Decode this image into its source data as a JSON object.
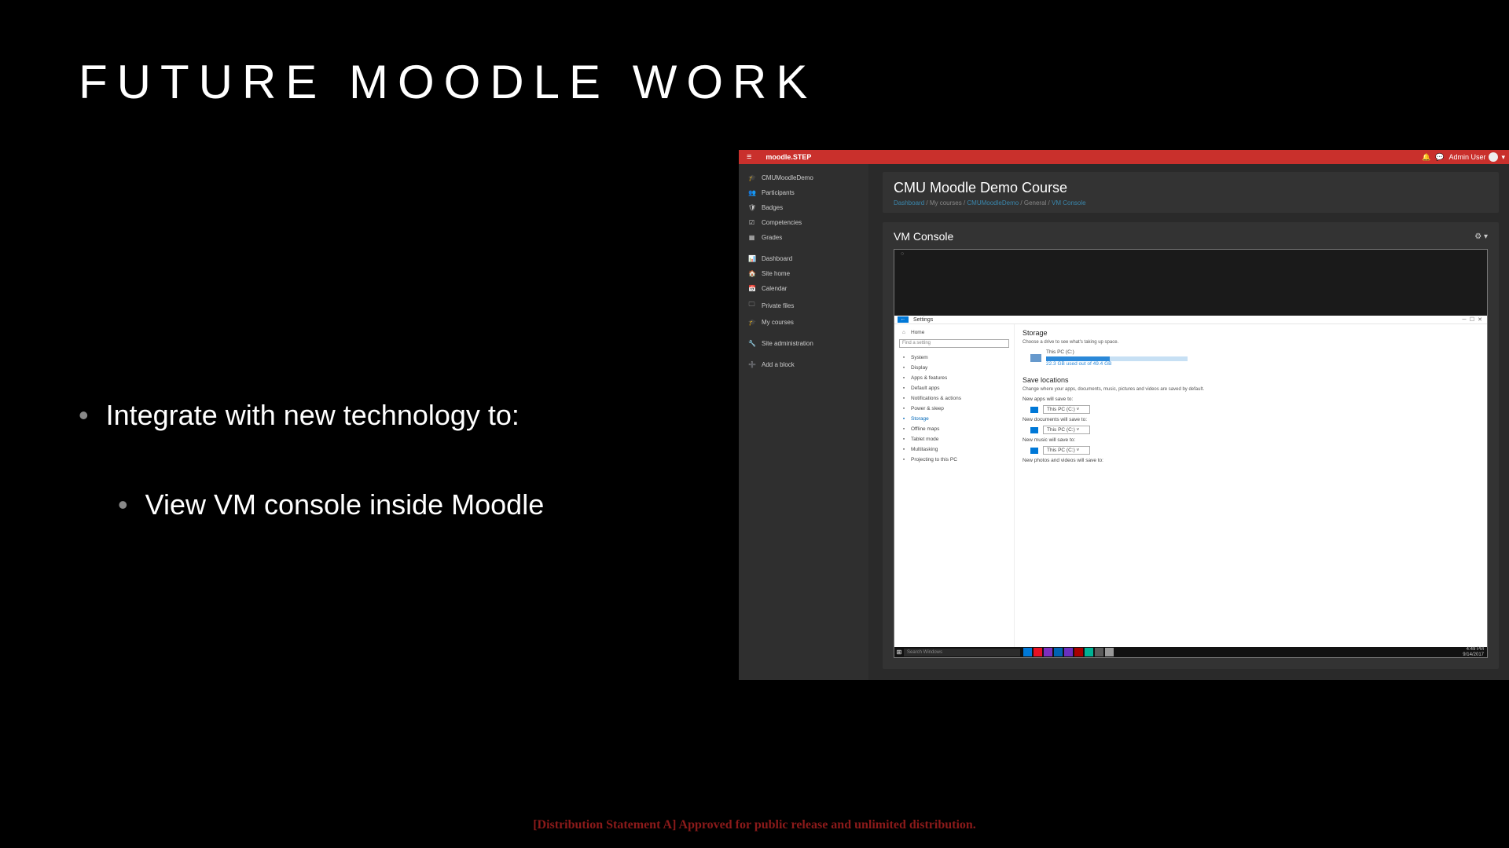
{
  "slide": {
    "title": "FUTURE MOODLE WORK",
    "bullet1": "Integrate with new technology to:",
    "bullet2": "View VM console inside Moodle",
    "footer": "[Distribution Statement A] Approved for public release and unlimited distribution."
  },
  "moodle": {
    "brand": "moodle.STEP",
    "user": "Admin User",
    "sidebar": [
      {
        "icon": "🎓",
        "label": "CMUMoodleDemo"
      },
      {
        "icon": "👥",
        "label": "Participants"
      },
      {
        "icon": "🛡",
        "label": "Badges"
      },
      {
        "icon": "☑",
        "label": "Competencies"
      },
      {
        "icon": "▦",
        "label": "Grades"
      }
    ],
    "sidebar2": [
      {
        "icon": "📊",
        "label": "Dashboard"
      },
      {
        "icon": "🏠",
        "label": "Site home"
      },
      {
        "icon": "📅",
        "label": "Calendar"
      },
      {
        "icon": "🗀",
        "label": "Private files"
      },
      {
        "icon": "🎓",
        "label": "My courses"
      }
    ],
    "sidebar3": [
      {
        "icon": "🔧",
        "label": "Site administration"
      }
    ],
    "sidebar4": [
      {
        "icon": "➕",
        "label": "Add a block"
      }
    ],
    "courseTitle": "CMU Moodle Demo Course",
    "breadcrumb": [
      "Dashboard",
      "My courses",
      "CMUMoodleDemo",
      "General",
      "VM Console"
    ],
    "vm": {
      "title": "VM Console"
    }
  },
  "windows": {
    "title": "Settings",
    "home": "Home",
    "searchPlaceholder": "Find a setting",
    "side": [
      "System",
      "Display",
      "Apps & features",
      "Default apps",
      "Notifications & actions",
      "Power & sleep",
      "Storage",
      "Offline maps",
      "Tablet mode",
      "Multitasking",
      "Projecting to this PC"
    ],
    "sideSelectedIndex": 6,
    "storage": {
      "heading": "Storage",
      "sub": "Choose a drive to see what's taking up space.",
      "drive": {
        "name": "This PC (C:)",
        "used": "22.3 GB used out of 49.4 GB"
      }
    },
    "save": {
      "heading": "Save locations",
      "sub": "Change where your apps, documents, music, pictures and videos are saved by default.",
      "rows": [
        {
          "label": "New apps will save to:",
          "value": "This PC (C:)"
        },
        {
          "label": "New documents will save to:",
          "value": "This PC (C:)"
        },
        {
          "label": "New music will save to:",
          "value": "This PC (C:)"
        },
        {
          "label": "New photos and videos will save to:",
          "value": ""
        }
      ]
    },
    "taskbar": {
      "search": "Search Windows",
      "time": "4:49 PM",
      "date": "9/14/2017",
      "iconColors": [
        "#0078d7",
        "#e81123",
        "#7b2fbf",
        "#0063b1",
        "#6b2fbf",
        "#a80000",
        "#00b294",
        "#5a5a5a",
        "#999"
      ]
    }
  }
}
